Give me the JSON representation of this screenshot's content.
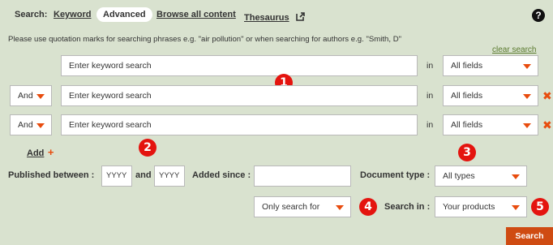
{
  "nav": {
    "label": "Search:",
    "keyword": "Keyword",
    "advanced": "Advanced",
    "browse": "Browse all content",
    "thesaurus": "Thesaurus",
    "external_icon": "external-link-icon",
    "help_icon": "help-icon",
    "help_glyph": "?"
  },
  "hint": "Please use quotation marks for searching phrases e.g. \"air pollution\" or when searching for authors e.g. \"Smith, D\"",
  "clear_search": "clear search",
  "rows": [
    {
      "placeholder": "Enter keyword search",
      "in_label": "in",
      "field": "All fields"
    },
    {
      "operator": "And",
      "placeholder": "Enter keyword search",
      "in_label": "in",
      "field": "All fields",
      "delete_glyph": "✖"
    },
    {
      "operator": "And",
      "placeholder": "Enter keyword search",
      "in_label": "in",
      "field": "All fields",
      "delete_glyph": "✖"
    }
  ],
  "add": {
    "label": "Add",
    "glyph": "+"
  },
  "filters": {
    "published_between": "Published between :",
    "from_year": "YYYY",
    "and_label": "and",
    "to_year": "YYYY",
    "added_since": "Added since :",
    "added_since_value": "",
    "document_type_label": "Document type :",
    "document_type": "All types",
    "only_search_for": "Only search for",
    "search_in_label": "Search in :",
    "search_in": "Your products"
  },
  "search_button": "Search",
  "badges": [
    "1",
    "2",
    "3",
    "4",
    "5"
  ],
  "colors": {
    "background": "#d9e2cf",
    "accent": "#e84c0e",
    "badge": "#e4140f",
    "button": "#cf4b12"
  }
}
